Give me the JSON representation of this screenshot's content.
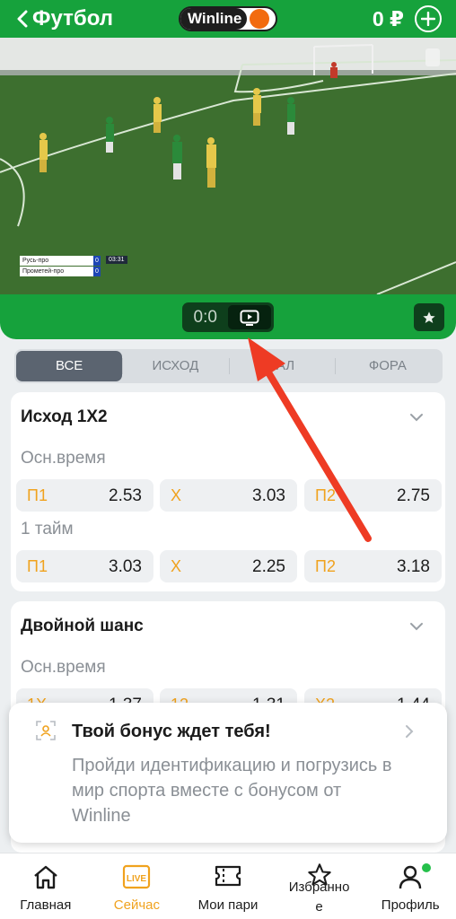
{
  "header": {
    "title": "Футбол",
    "brand": "Winline",
    "balance": "0 ₽",
    "back_icon": "chevron-left-icon",
    "add_icon": "plus-circle-icon"
  },
  "video": {
    "scoreboard": {
      "team1": "Русь-про",
      "team1_score": "0",
      "team2": "Прометей-про",
      "team2_score": "0",
      "time": "03:31"
    }
  },
  "scorebar": {
    "score": "0:0",
    "tv_icon": "tv-icon",
    "favorite_icon": "star-icon"
  },
  "tabs": [
    {
      "label": "ВСЕ",
      "active": true
    },
    {
      "label": "ИСХОД",
      "active": false
    },
    {
      "label": "ТАЛ",
      "active": false
    },
    {
      "label": "ФОРА",
      "active": false
    }
  ],
  "markets": {
    "outcome": {
      "title": "Исход 1Х2",
      "groups": [
        {
          "period": "Осн.время",
          "odds": [
            {
              "label": "П1",
              "value": "2.53"
            },
            {
              "label": "Х",
              "value": "3.03"
            },
            {
              "label": "П2",
              "value": "2.75"
            }
          ]
        },
        {
          "period": "1 тайм",
          "odds": [
            {
              "label": "П1",
              "value": "3.03"
            },
            {
              "label": "Х",
              "value": "2.25"
            },
            {
              "label": "П2",
              "value": "3.18"
            }
          ]
        }
      ]
    },
    "double": {
      "title": "Двойной шанс",
      "period": "Осн.время",
      "odds": [
        {
          "label": "1Х",
          "value": "1.37"
        },
        {
          "label": "12",
          "value": "1.31"
        },
        {
          "label": "Х2",
          "value": "1.44"
        }
      ]
    }
  },
  "bonus": {
    "title": "Твой бонус ждет тебя!",
    "text": "Пройди идентификацию и погрузись в мир спорта вместе с бонусом от Winline"
  },
  "nav": [
    {
      "label": "Главная",
      "icon": "home-icon",
      "active": false
    },
    {
      "label": "Сейчас",
      "icon": "live-icon",
      "active": true,
      "badge": "LIVE"
    },
    {
      "label": "Мои пари",
      "icon": "ticket-icon",
      "active": false
    },
    {
      "label": "Избранно\nе",
      "icon": "star-outline-icon",
      "active": false
    },
    {
      "label": "Профиль",
      "icon": "user-icon",
      "active": false
    }
  ],
  "colors": {
    "brand_green": "#16a23c",
    "dark_green": "#0e3f1c",
    "accent_orange": "#f0a21e",
    "annotation_red": "#ee3b24"
  }
}
